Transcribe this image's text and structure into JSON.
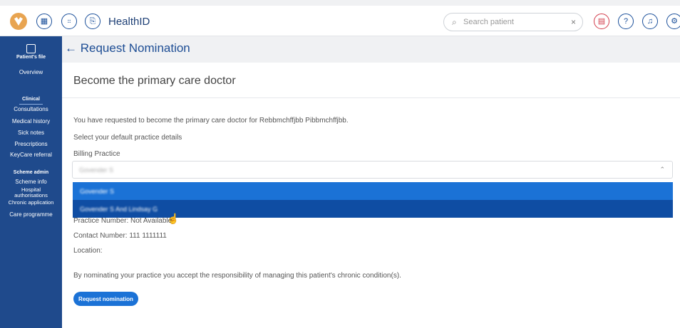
{
  "header": {
    "app_title": "HealthID",
    "search": {
      "placeholder": "Search patient",
      "clear": "×"
    },
    "icons": [
      "calendar-icon",
      "team-icon",
      "clipboard-icon",
      "chat-icon",
      "help-icon",
      "notification-icon",
      "settings-icon"
    ]
  },
  "sidebar": {
    "patient_file": "Patient's file",
    "items": [
      {
        "label": "Overview",
        "heading": false
      },
      {
        "label": "Clinical",
        "heading": true
      },
      {
        "label": "Consultations",
        "heading": false
      },
      {
        "label": "Medical history",
        "heading": false
      },
      {
        "label": "Sick notes",
        "heading": false
      },
      {
        "label": "Prescriptions",
        "heading": false
      },
      {
        "label": "KeyCare referral",
        "heading": false
      },
      {
        "label": "Scheme admin",
        "heading": true
      },
      {
        "label": "Scheme info",
        "heading": false
      },
      {
        "label": "Hospital",
        "heading": false
      },
      {
        "label": "authorisations",
        "heading": false
      },
      {
        "label": "Chronic application",
        "heading": false
      },
      {
        "label": "Care programme",
        "heading": false
      }
    ]
  },
  "page": {
    "back_arrow": "←",
    "title": "Request Nomination",
    "card_title": "Become the primary care doctor",
    "intro": "You have requested to become the primary care doctor for Rebbmchffjbb Pibbmchffjbb.",
    "select_label": "Select your default practice details",
    "billing_label": "Billing Practice",
    "billing_value": "Govender S",
    "options": [
      "Govender S",
      "Govender S And Lindsay G"
    ],
    "practice_number": "Practice Number: Not Available",
    "contact_number": "Contact Number: 111 1111111",
    "location": "Location:",
    "disclaimer": "By nominating your practice you accept the responsibility of managing this patient's chronic condition(s).",
    "button": "Request nomination"
  },
  "colors": {
    "sidebar": "#1f4a8c",
    "accent": "#1b72d6",
    "selected": "#0f4da3",
    "logo": "#e8a451"
  }
}
